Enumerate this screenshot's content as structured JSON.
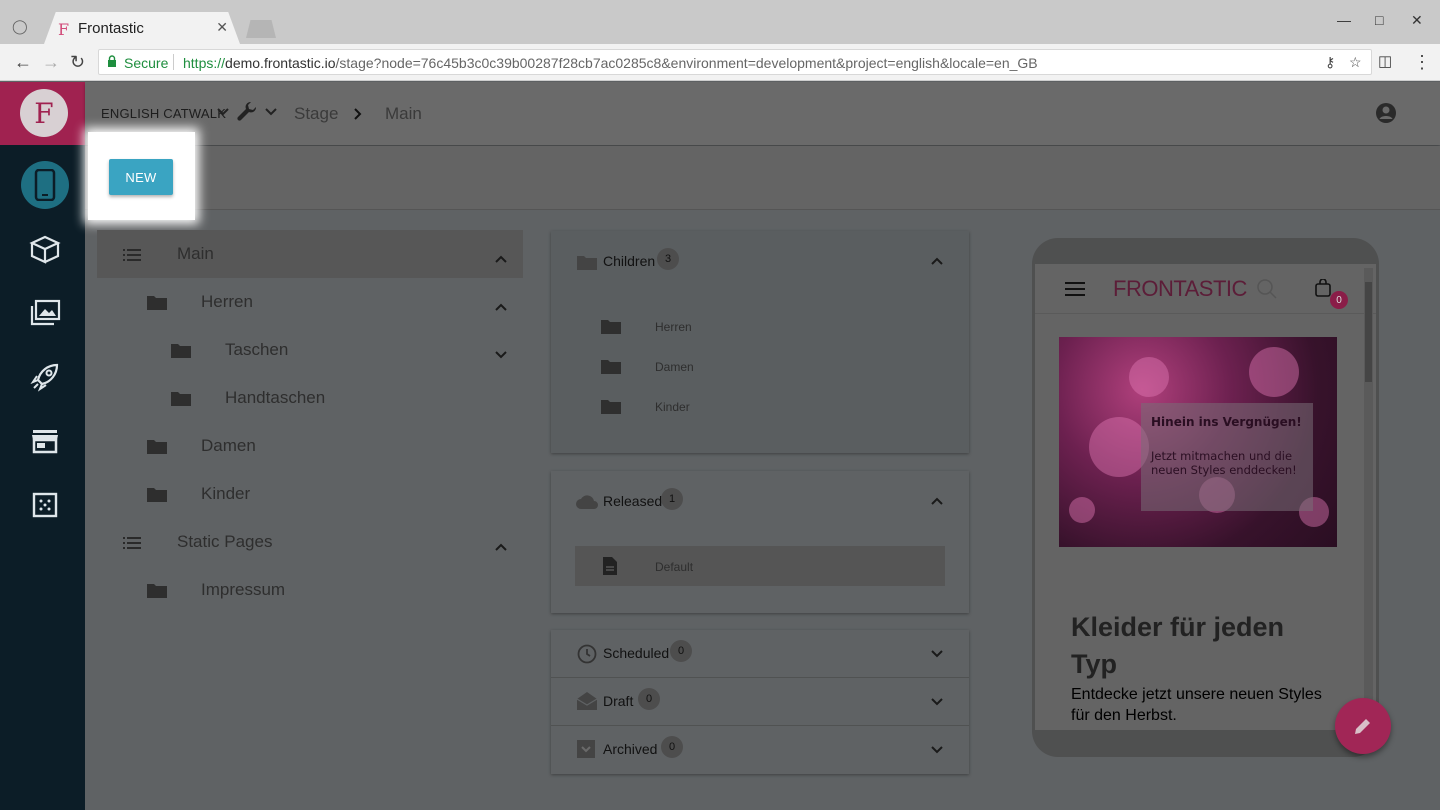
{
  "browser": {
    "tab_title": "Frontastic",
    "favicon": "F",
    "secure_label": "Secure",
    "url_scheme": "https://",
    "url_host": "demo.frontastic.io",
    "url_rest": "/stage?node=76c45b3c0c39b00287f28cb7ac0285c8&environment=development&project=english&locale=en_GB"
  },
  "logo_letter": "F",
  "topbar": {
    "project": "ENGLISH CATWALK",
    "breadcrumb": [
      "Stage",
      "Main"
    ]
  },
  "toolbar": {
    "new_label": "NEW"
  },
  "tree": [
    {
      "label": "Main",
      "icon": "list-icon",
      "level": 0,
      "chevron": "up",
      "selected": true
    },
    {
      "label": "Herren",
      "icon": "folder-icon",
      "level": 1,
      "chevron": "up"
    },
    {
      "label": "Taschen",
      "icon": "folder-icon",
      "level": 2,
      "chevron": "down"
    },
    {
      "label": "Handtaschen",
      "icon": "folder-icon",
      "level": 2,
      "chevron": ""
    },
    {
      "label": "Damen",
      "icon": "folder-icon",
      "level": 1,
      "chevron": ""
    },
    {
      "label": "Kinder",
      "icon": "folder-icon",
      "level": 1,
      "chevron": ""
    },
    {
      "label": "Static Pages",
      "icon": "list-icon",
      "level": 0,
      "chevron": "up"
    },
    {
      "label": "Impressum",
      "icon": "folder-icon",
      "level": 1,
      "chevron": ""
    }
  ],
  "children_panel": {
    "title": "Children",
    "count": "3",
    "items": [
      "Herren",
      "Damen",
      "Kinder"
    ]
  },
  "released_panel": {
    "title": "Released",
    "count": "1",
    "items": [
      "Default"
    ]
  },
  "scheduled_panel": {
    "title": "Scheduled",
    "count": "0"
  },
  "draft_panel": {
    "title": "Draft",
    "count": "0"
  },
  "archived_panel": {
    "title": "Archived",
    "count": "0"
  },
  "preview": {
    "brand": "FRONTASTIC",
    "cart_count": "0",
    "promo_title": "Hinein ins Vergnügen!",
    "promo_text": "Jetzt mitmachen und die neuen Styles enddecken!",
    "headline": "Kleider für jeden Typ",
    "subline": "Entdecke jetzt unsere neuen Styles für den Herbst."
  },
  "colors": {
    "brand": "#a02250",
    "accent": "#3aa4c2",
    "sidebar": "#0c1d27"
  }
}
